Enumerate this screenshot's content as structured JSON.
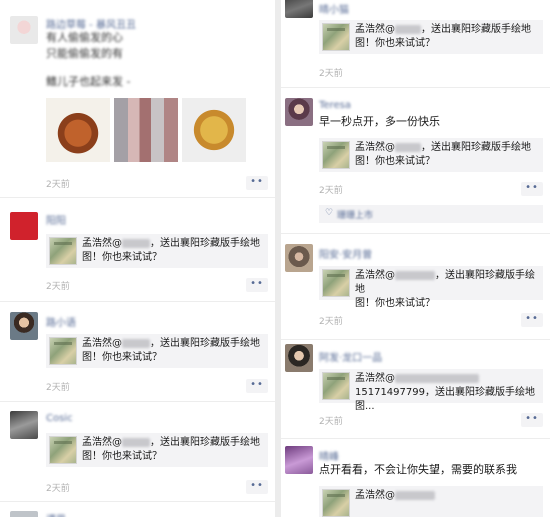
{
  "promo_card": {
    "sender": "孟浩然@",
    "line1_rest": "，送出襄阳珍藏版手绘地",
    "line2": "图！你也来试试？",
    "line1_full_rest_right": "，送出襄阳珍藏版手绘地"
  },
  "left": {
    "post1": {
      "line1": "有人偷偷发的心",
      "line2": "只能偷偷发的有",
      "line3": "鳍儿子也起来发 -",
      "time": "2天前",
      "more": "••"
    },
    "post2": {
      "time": "2天前",
      "more": "••"
    },
    "post3": {
      "time": "2天前",
      "more": "••"
    },
    "post4": {
      "username": "Cosic",
      "time": "2天前",
      "more": "••"
    }
  },
  "right": {
    "post1": {
      "time": "2天前"
    },
    "post2": {
      "username": "Teresa",
      "text": "早一秒点开，多一份快乐",
      "time": "2天前",
      "more": "••"
    },
    "post3": {
      "time": "2天前",
      "more": "••"
    },
    "post4": {
      "username": "阿发·龙口一品",
      "card_line2": "15171497799，送出襄阳珍藏版手绘地图...",
      "time": "2天前",
      "more": "••"
    },
    "post5": {
      "text": "点开看看，不会让你失望，需要的联系我"
    }
  },
  "colors": {
    "link": "#576b95",
    "card_bg": "#f3f3f5",
    "time": "#b2b2b2"
  }
}
